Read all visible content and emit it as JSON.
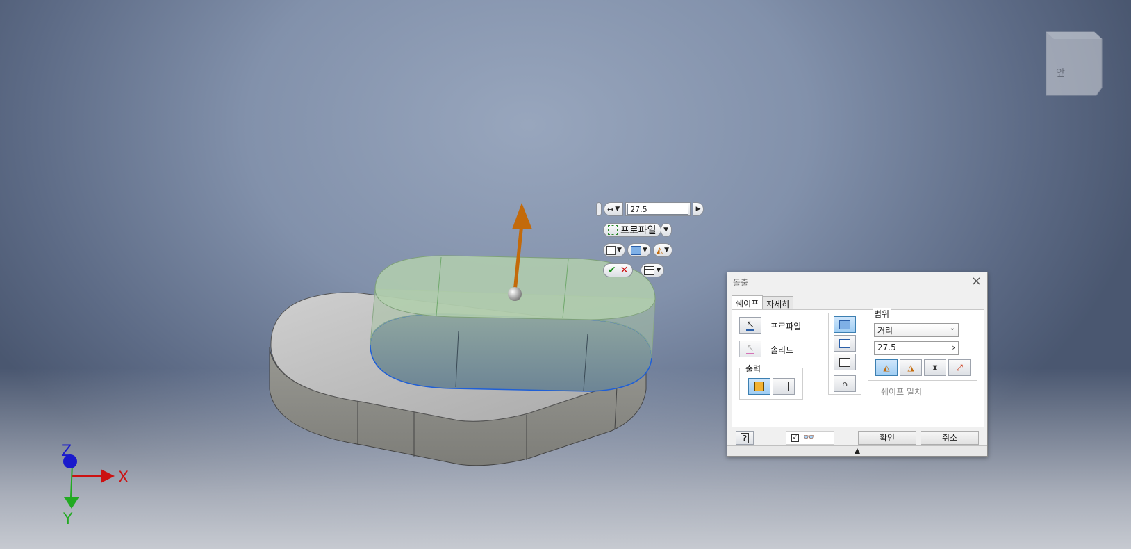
{
  "viewcube": {
    "label": "앞"
  },
  "axes": {
    "x": "X",
    "y": "Y",
    "z": "Z"
  },
  "mini_toolbar": {
    "distance_value": "27.5",
    "profile_label": "프로파일"
  },
  "dialog": {
    "title": "돌출",
    "tabs": [
      {
        "label": "쉐이프"
      },
      {
        "label": "자세히"
      }
    ],
    "profile_label": "프로파일",
    "solid_label": "솔리드",
    "output_label": "출력",
    "extent_label": "범위",
    "extent_type": "거리",
    "distance_value": "27.5",
    "match_shape_label": "쉐이프 일치",
    "ok_label": "확인",
    "cancel_label": "취소",
    "help_label": "?"
  },
  "colors": {
    "arrow": "#c36a0a",
    "preview": "#a8c9a2",
    "highlight_edge": "#1f5fd6",
    "x_axis": "#cc1111",
    "y_axis": "#22aa22",
    "z_axis": "#1a1acc"
  }
}
